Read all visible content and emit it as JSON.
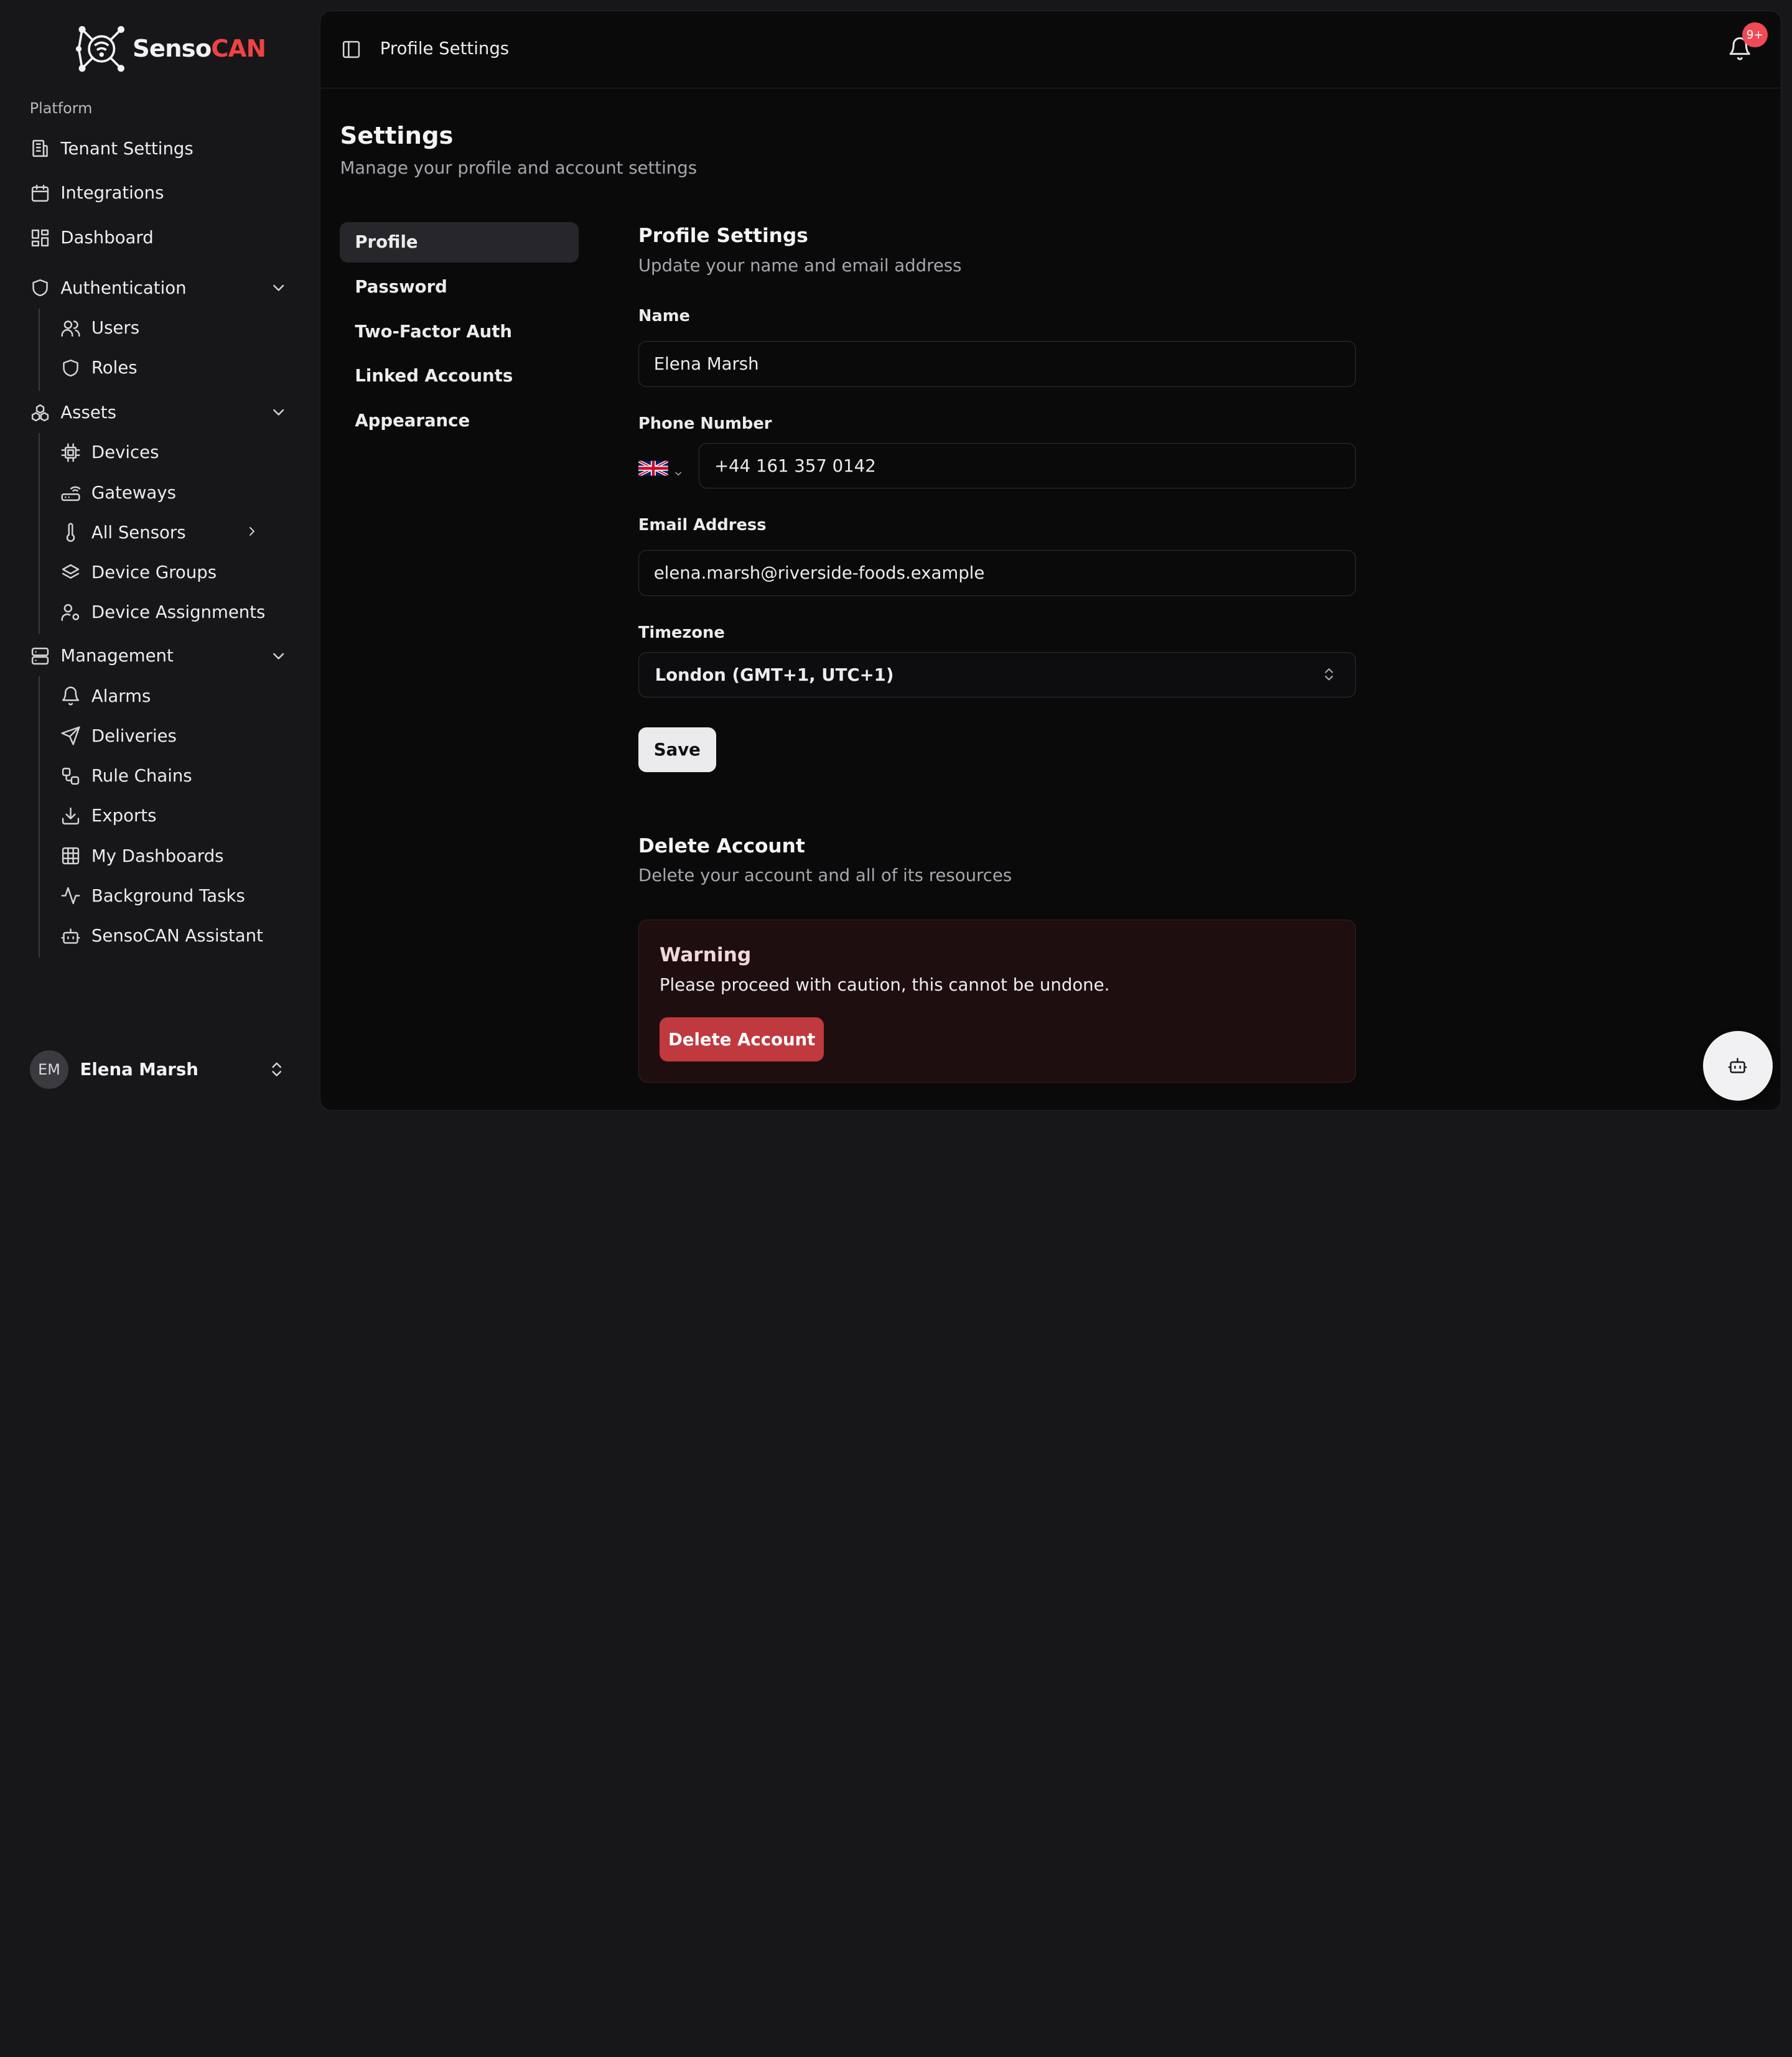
{
  "app": {
    "brand_part1": "Senso",
    "brand_part2": "CAN",
    "brand_accent_color": "#ef4343"
  },
  "sidebar": {
    "group_label": "Platform",
    "items": [
      {
        "label": "Tenant Settings",
        "icon": "building-icon"
      },
      {
        "label": "Integrations",
        "icon": "calendar-icon"
      },
      {
        "label": "Dashboard",
        "icon": "layout-grid-icon"
      }
    ],
    "authentication": {
      "label": "Authentication",
      "items": [
        {
          "label": "Users",
          "icon": "users-icon"
        },
        {
          "label": "Roles",
          "icon": "shield-icon"
        }
      ]
    },
    "assets": {
      "label": "Assets",
      "items": [
        {
          "label": "Devices",
          "icon": "cpu-icon"
        },
        {
          "label": "Gateways",
          "icon": "router-icon"
        },
        {
          "label": "All Sensors",
          "icon": "thermometer-icon"
        },
        {
          "label": "Device Groups",
          "icon": "layers-icon"
        },
        {
          "label": "Device Assignments",
          "icon": "user-cog-icon"
        }
      ]
    },
    "management": {
      "label": "Management",
      "items": [
        {
          "label": "Alarms",
          "icon": "bell-icon"
        },
        {
          "label": "Deliveries",
          "icon": "send-icon"
        },
        {
          "label": "Rule Chains",
          "icon": "workflow-icon"
        },
        {
          "label": "Exports",
          "icon": "download-icon"
        },
        {
          "label": "My Dashboards",
          "icon": "table-grid-icon"
        },
        {
          "label": "Background Tasks",
          "icon": "activity-icon"
        },
        {
          "label": "SensoCAN Assistant",
          "icon": "bot-icon"
        }
      ]
    },
    "user": {
      "initials": "EM",
      "name": "Elena Marsh"
    }
  },
  "header": {
    "breadcrumb": "Profile Settings",
    "notification_badge": "9+"
  },
  "page": {
    "title": "Settings",
    "subtitle": "Manage your profile and account settings"
  },
  "tabs": [
    {
      "label": "Profile",
      "active": true
    },
    {
      "label": "Password"
    },
    {
      "label": "Two-Factor Auth"
    },
    {
      "label": "Linked Accounts"
    },
    {
      "label": "Appearance"
    }
  ],
  "profile": {
    "title": "Profile Settings",
    "subtitle": "Update your name and email address",
    "name_label": "Name",
    "name_value": "Elena Marsh",
    "phone_label": "Phone Number",
    "phone_value": "+44 161 357 0142",
    "email_label": "Email Address",
    "email_value": "elena.marsh@riverside-foods.example",
    "timezone_label": "Timezone",
    "timezone_value": "London (GMT+1, UTC+1)",
    "save_label": "Save"
  },
  "delete": {
    "title": "Delete Account",
    "subtitle": "Delete your account and all of its resources",
    "warning_title": "Warning",
    "warning_text": "Please proceed with caution, this cannot be undone.",
    "button_label": "Delete Account"
  }
}
